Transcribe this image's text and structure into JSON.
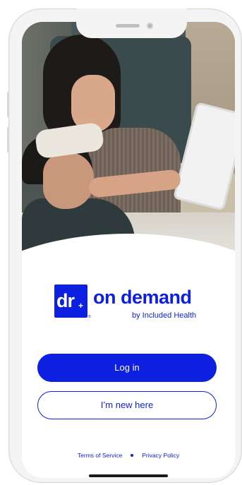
{
  "brand": {
    "logo_mark": "dr",
    "logo_plus": "+",
    "logo_registered": "®",
    "name": "on demand",
    "tagline": "by Included Health",
    "color": "#0d1fe0"
  },
  "actions": {
    "login_label": "Log in",
    "new_user_label": "I’m new here"
  },
  "footer": {
    "terms_label": "Terms of Service",
    "privacy_label": "Privacy Policy"
  },
  "hero": {
    "icon": "hero-photo-mother-and-child"
  }
}
